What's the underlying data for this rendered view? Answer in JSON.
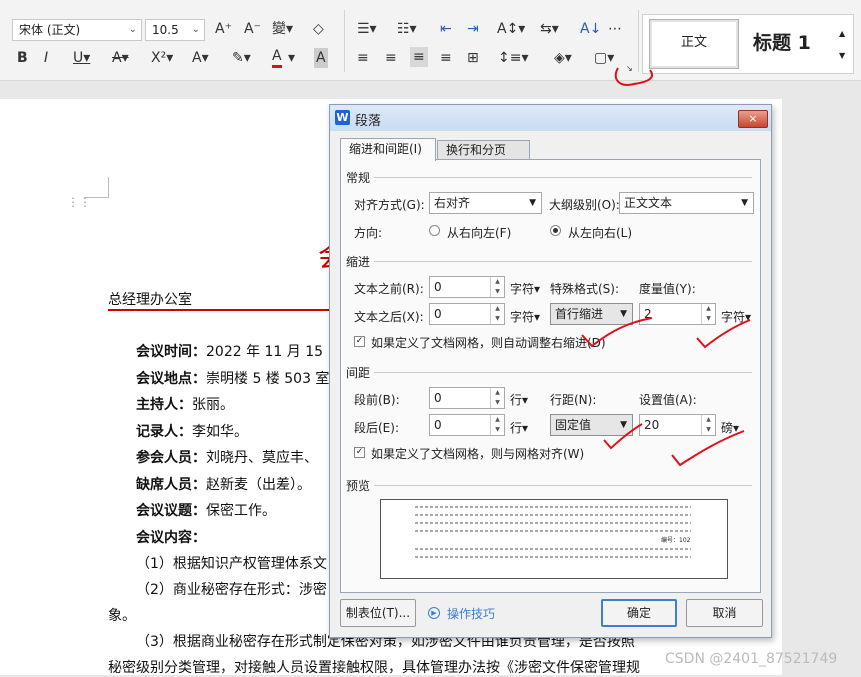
{
  "ribbon": {
    "font_name": "宋体 (正文)",
    "font_size": "10.5",
    "style_normal": "正文",
    "style_heading": "标题 1"
  },
  "document": {
    "dept": "总经理办公室",
    "lines": [
      {
        "label": "会议时间：",
        "value": "2022 年 11 月 15 日"
      },
      {
        "label": "会议地点：",
        "value": "崇明楼 5 楼 503 室"
      },
      {
        "label": "主持人：",
        "value": "张丽。"
      },
      {
        "label": "记录人：",
        "value": "李如华。"
      },
      {
        "label": "参会人员：",
        "value": "刘晓丹、莫应丰、"
      },
      {
        "label": "缺席人员：",
        "value": "赵新麦（出差）。"
      },
      {
        "label": "会议议题：",
        "value": "保密工作。"
      },
      {
        "label": "会议内容：",
        "value": ""
      }
    ],
    "item1": "（1）根据知识产权管理体系文",
    "item2": "（2）商业秘密存在形式：涉密",
    "item2_tail": "象。",
    "item3": "（3）根据商业秘密存在形式制定保密对策，如涉密文件由谁负责管理，是否按照",
    "item3_line2": "秘密级别分类管理，对接触人员设置接触权限，具体管理办法按《涉密文件保密管理规",
    "partial_title": "会"
  },
  "dialog": {
    "logo": "W",
    "title": "段落",
    "close": "×",
    "tab_indent": "缩进和间距(I)",
    "tab_pagination": "换行和分页(P)",
    "general": {
      "section": "常规",
      "align_label": "对齐方式(G):",
      "align_value": "右对齐",
      "outline_label": "大纲级别(O):",
      "outline_value": "正文文本",
      "direction_label": "方向:",
      "rtl": "从右向左(F)",
      "ltr": "从左向右(L)"
    },
    "indent": {
      "section": "缩进",
      "before_label": "文本之前(R):",
      "before_value": "0",
      "before_unit": "字符▾",
      "after_label": "文本之后(X):",
      "after_value": "0",
      "after_unit": "字符▾",
      "special_label": "特殊格式(S):",
      "special_value": "首行缩进",
      "measure_label": "度量值(Y):",
      "measure_value": "2",
      "measure_unit": "字符▾",
      "auto_adjust": "如果定义了文档网格，则自动调整右缩进(D)"
    },
    "spacing": {
      "section": "间距",
      "before_label": "段前(B):",
      "before_value": "0",
      "before_unit": "行▾",
      "after_label": "段后(E):",
      "after_value": "0",
      "after_unit": "行▾",
      "line_label": "行距(N):",
      "line_value": "固定值",
      "setting_label": "设置值(A):",
      "setting_value": "20",
      "setting_unit": "磅▾",
      "grid_align": "如果定义了文档网格，则与网格对齐(W)"
    },
    "preview": {
      "section": "预览",
      "sample": "编号：102"
    },
    "buttons": {
      "tabs": "制表位(T)...",
      "tips": "操作技巧",
      "ok": "确定",
      "cancel": "取消"
    }
  },
  "watermark": "CSDN @2401_87521749",
  "colors": {
    "annotation_red": "#e0101a",
    "dialog_accent": "#3c7fd1",
    "doc_rule_red": "#cc0000"
  }
}
